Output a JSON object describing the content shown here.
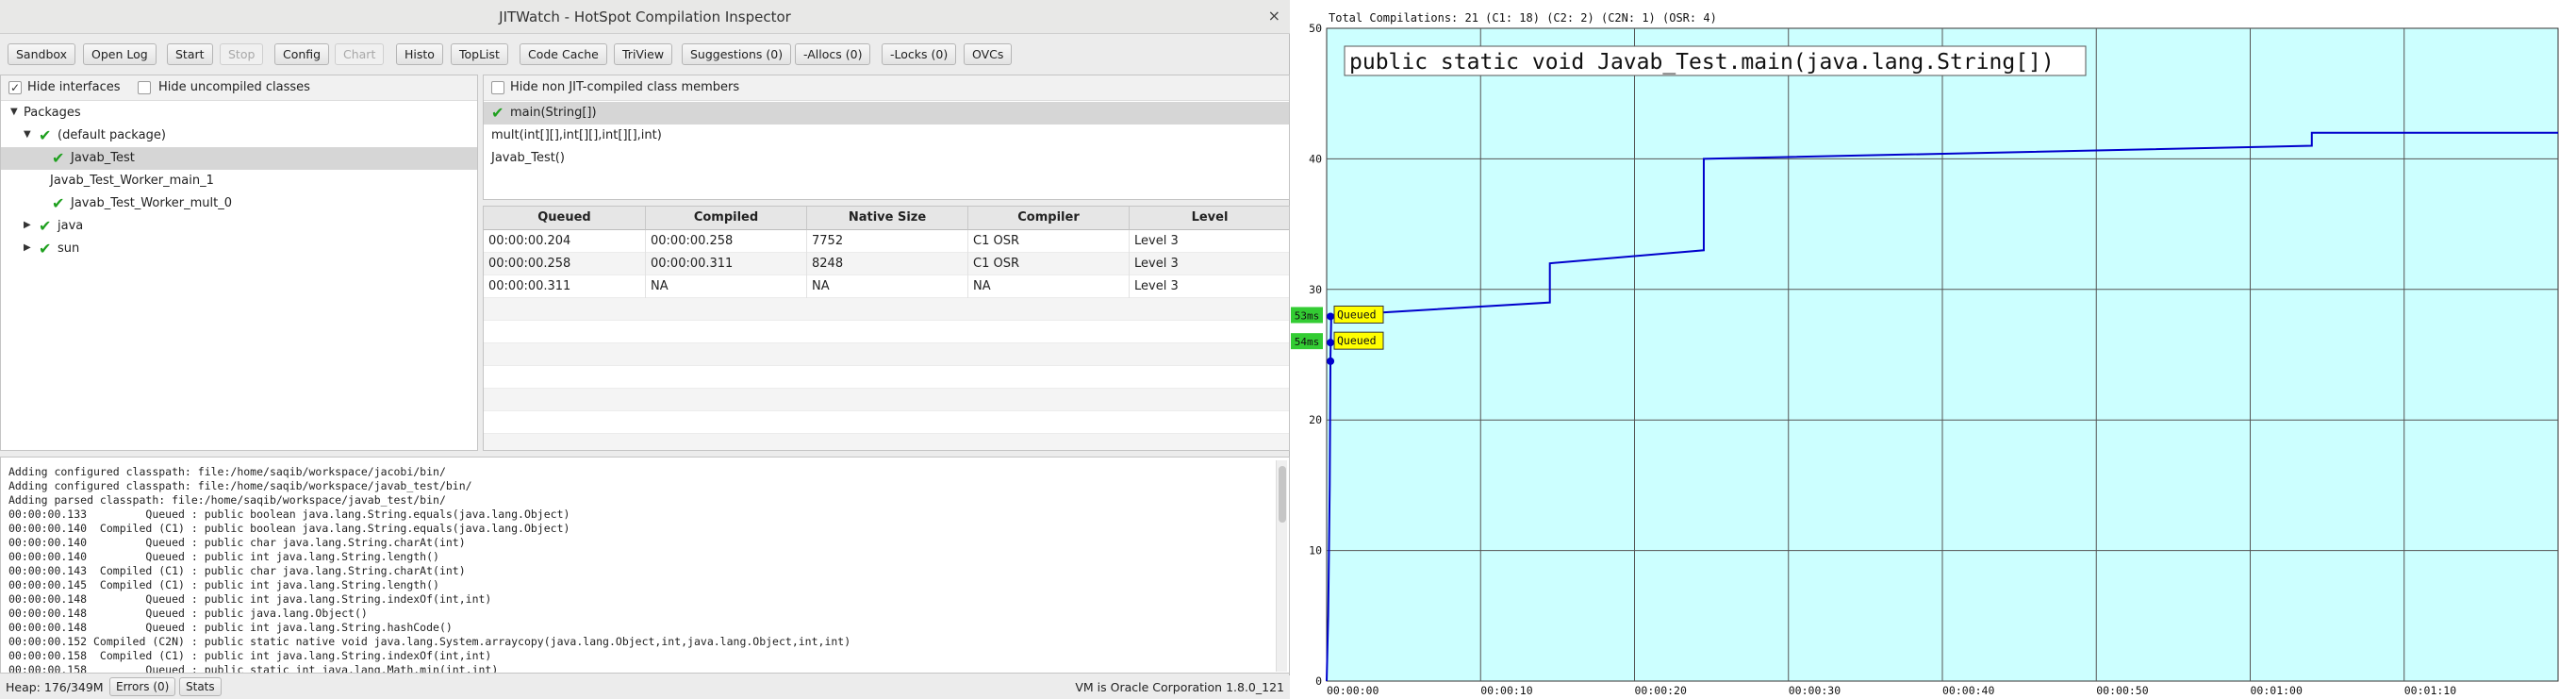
{
  "window": {
    "title": "JITWatch - HotSpot Compilation Inspector",
    "close_glyph": "×"
  },
  "toolbar": {
    "buttons": [
      {
        "label": "Sandbox",
        "enabled": true
      },
      {
        "label": "Open Log",
        "enabled": true
      },
      {
        "label": "Start",
        "enabled": true
      },
      {
        "label": "Stop",
        "enabled": false
      },
      {
        "label": "Config",
        "enabled": true
      },
      {
        "label": "Chart",
        "enabled": false
      },
      {
        "label": "Histo",
        "enabled": true
      },
      {
        "label": "TopList",
        "enabled": true
      },
      {
        "label": "Code Cache",
        "enabled": true
      },
      {
        "label": "TriView",
        "enabled": true
      },
      {
        "label": "Suggestions (0)",
        "enabled": true
      },
      {
        "label": "-Allocs (0)",
        "enabled": true
      },
      {
        "label": "-Locks (0)",
        "enabled": true
      },
      {
        "label": "OVCs",
        "enabled": true
      }
    ]
  },
  "tree": {
    "hide_interfaces": {
      "label": "Hide interfaces",
      "checked": true
    },
    "hide_uncompiled": {
      "label": "Hide uncompiled classes",
      "checked": false
    },
    "nodes": [
      {
        "label": "Packages",
        "expander": "▼",
        "check": false,
        "selected": false
      },
      {
        "label": "(default package)",
        "expander": "▼",
        "check": true,
        "selected": false
      },
      {
        "label": "Javab_Test",
        "expander": "",
        "check": true,
        "selected": true
      },
      {
        "label": "Javab_Test_Worker_main_1",
        "expander": "",
        "check": false,
        "selected": false
      },
      {
        "label": "Javab_Test_Worker_mult_0",
        "expander": "",
        "check": true,
        "selected": false
      },
      {
        "label": "java",
        "expander": "▶",
        "check": true,
        "selected": false
      },
      {
        "label": "sun",
        "expander": "▶",
        "check": true,
        "selected": false
      }
    ]
  },
  "members": {
    "hide_non_jit": {
      "label": "Hide non JIT-compiled class members",
      "checked": false
    },
    "items": [
      {
        "label": "main(String[])",
        "check": true,
        "selected": true
      },
      {
        "label": "mult(int[][],int[][],int[][],int)",
        "check": false,
        "selected": false
      },
      {
        "label": "Javab_Test()",
        "check": false,
        "selected": false
      }
    ]
  },
  "compilations": {
    "columns": [
      "Queued",
      "Compiled",
      "Native Size",
      "Compiler",
      "Level"
    ],
    "rows": [
      [
        "00:00:00.204",
        "00:00:00.258",
        "7752",
        "C1 OSR",
        "Level 3"
      ],
      [
        "00:00:00.258",
        "00:00:00.311",
        "8248",
        "C1 OSR",
        "Level 3"
      ],
      [
        "00:00:00.311",
        "NA",
        "NA",
        "NA",
        "Level 3"
      ]
    ]
  },
  "log": {
    "lines": [
      "Adding configured classpath: file:/home/saqib/workspace/jacobi/bin/",
      "Adding configured classpath: file:/home/saqib/workspace/javab_test/bin/",
      "Adding parsed classpath: file:/home/saqib/workspace/javab_test/bin/",
      "00:00:00.133         Queued : public boolean java.lang.String.equals(java.lang.Object)",
      "00:00:00.140  Compiled (C1) : public boolean java.lang.String.equals(java.lang.Object)",
      "00:00:00.140         Queued : public char java.lang.String.charAt(int)",
      "00:00:00.140         Queued : public int java.lang.String.length()",
      "00:00:00.143  Compiled (C1) : public char java.lang.String.charAt(int)",
      "00:00:00.145  Compiled (C1) : public int java.lang.String.length()",
      "00:00:00.148         Queued : public int java.lang.String.indexOf(int,int)",
      "00:00:00.148         Queued : public java.lang.Object()",
      "00:00:00.148         Queued : public int java.lang.String.hashCode()",
      "00:00:00.152 Compiled (C2N) : public static native void java.lang.System.arraycopy(java.lang.Object,int,java.lang.Object,int,int)",
      "00:00:00.158  Compiled (C1) : public int java.lang.String.indexOf(int,int)",
      "00:00:00.158         Queued : public static int java.lang.Math.min(int,int)"
    ]
  },
  "status": {
    "heap": "Heap: 176/349M",
    "errors_button": "Errors (0)",
    "stats_button": "Stats",
    "vm": "VM is Oracle Corporation 1.8.0_121"
  },
  "colors": {
    "plot_bg": "#ccffff",
    "grid": "#555555",
    "line": "#0000cc",
    "label_box": "#ffff00",
    "time_badge": "#33cc33"
  },
  "chart_data": {
    "type": "line",
    "title": "Total Compilations: 21 (C1: 18) (C2: 2) (C2N: 1) (OSR: 4)",
    "selected_member_label": "public static void Javab_Test.main(java.lang.String[])",
    "x_ticks": [
      "00:00:00",
      "00:00:10",
      "00:00:20",
      "00:00:30",
      "00:00:40",
      "00:00:50",
      "00:01:00",
      "00:01:10"
    ],
    "x_tick_values": [
      0,
      10,
      20,
      30,
      40,
      50,
      60,
      70
    ],
    "y_ticks": [
      0,
      10,
      20,
      30,
      40,
      50
    ],
    "xlim": [
      0,
      80
    ],
    "ylim": [
      0,
      50
    ],
    "grid": true,
    "series": [
      {
        "points": [
          [
            0,
            0
          ],
          [
            0.1,
            5
          ],
          [
            0.2,
            15
          ],
          [
            0.25,
            25
          ],
          [
            0.3,
            28
          ],
          [
            14.5,
            29
          ],
          [
            14.5,
            32
          ],
          [
            24.5,
            33
          ],
          [
            24.5,
            40
          ],
          [
            64,
            41
          ],
          [
            64,
            42
          ],
          [
            80,
            42
          ]
        ]
      }
    ],
    "events": [
      {
        "badge": "53ms",
        "label": "Queued",
        "y": 28
      },
      {
        "badge": "54ms",
        "label": "Queued",
        "y": 26
      }
    ]
  }
}
